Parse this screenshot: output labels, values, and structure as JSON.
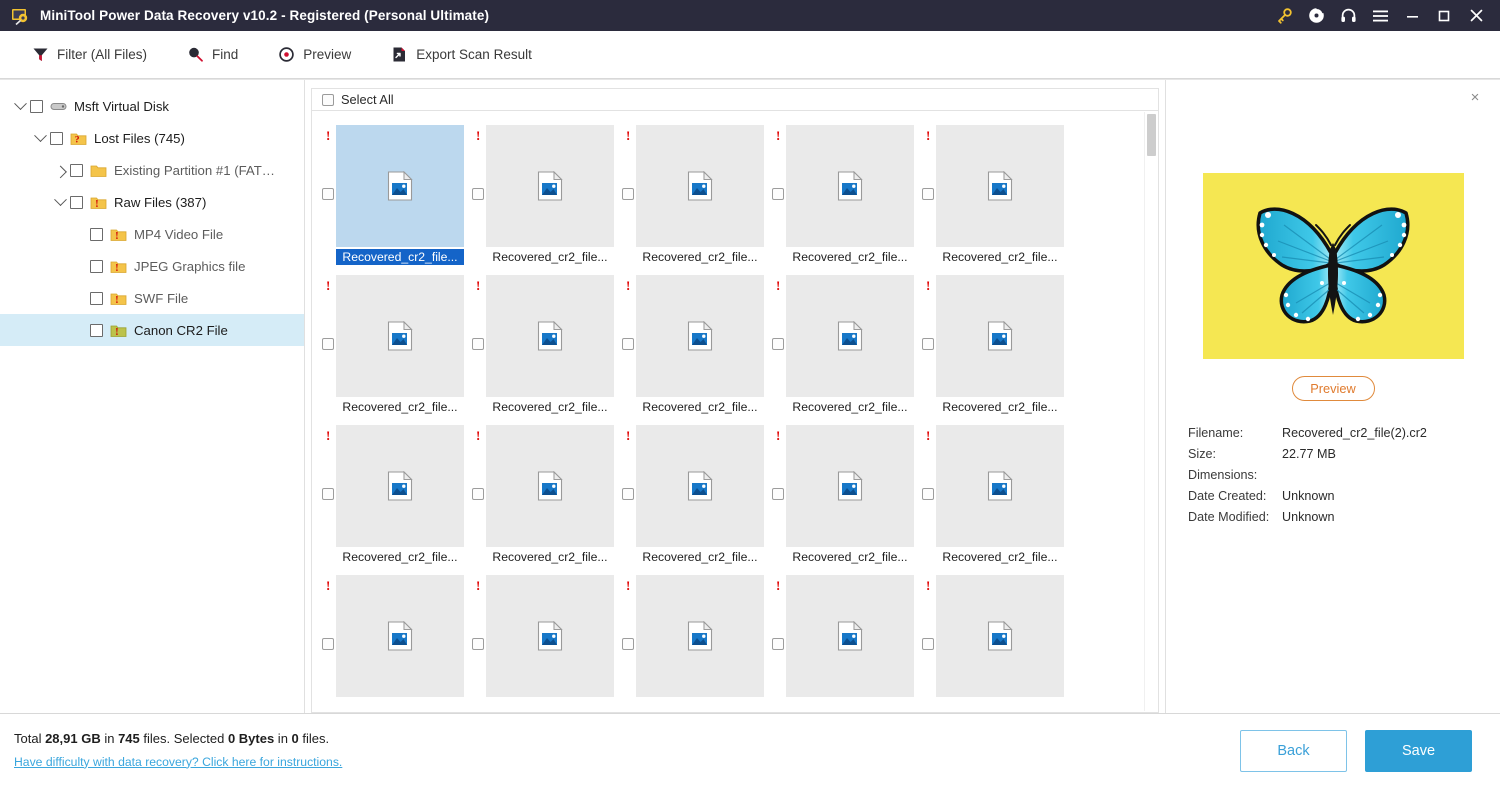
{
  "window": {
    "title": "MiniTool Power Data Recovery v10.2 - Registered (Personal Ultimate)",
    "app_icon": "minitool-app-icon",
    "controls": [
      {
        "name": "key-icon",
        "glyph": "key"
      },
      {
        "name": "disc-icon",
        "glyph": "disc"
      },
      {
        "name": "headphones-icon",
        "glyph": "headphones"
      },
      {
        "name": "menu-icon",
        "glyph": "hamburger"
      },
      {
        "name": "minimize-button",
        "glyph": "minimize"
      },
      {
        "name": "maximize-button",
        "glyph": "maximize"
      },
      {
        "name": "close-button",
        "glyph": "close"
      }
    ]
  },
  "toolbar": {
    "items": [
      {
        "label": "Filter (All Files)",
        "icon": "filter-icon"
      },
      {
        "label": "Find",
        "icon": "search-icon"
      },
      {
        "label": "Preview",
        "icon": "eye-icon"
      },
      {
        "label": "Export Scan Result",
        "icon": "export-icon"
      }
    ]
  },
  "sidebar": {
    "items": [
      {
        "label": "Msft Virtual Disk",
        "indent": 0,
        "twisty": "down",
        "icon": "disk-icon",
        "checked": false,
        "selected": false
      },
      {
        "label": "Lost Files (745)",
        "indent": 1,
        "twisty": "down",
        "icon": "folder-question-icon",
        "checked": false,
        "selected": false
      },
      {
        "label": "Existing Partition #1 (FAT…",
        "indent": 2,
        "twisty": "right",
        "icon": "folder-icon",
        "checked": false,
        "selected": false,
        "dim": true
      },
      {
        "label": "Raw Files (387)",
        "indent": 2,
        "twisty": "down",
        "icon": "folder-alert-icon",
        "checked": false,
        "selected": false
      },
      {
        "label": "MP4 Video File",
        "indent": 3,
        "twisty": "none",
        "icon": "folder-alert-icon",
        "checked": false,
        "selected": false,
        "dim": true
      },
      {
        "label": "JPEG Graphics file",
        "indent": 3,
        "twisty": "none",
        "icon": "folder-alert-icon",
        "checked": false,
        "selected": false,
        "dim": true
      },
      {
        "label": "SWF File",
        "indent": 3,
        "twisty": "none",
        "icon": "folder-alert-icon",
        "checked": false,
        "selected": false,
        "dim": true
      },
      {
        "label": "Canon CR2 File",
        "indent": 3,
        "twisty": "none",
        "icon": "folder-alert-green-icon",
        "checked": false,
        "selected": true
      }
    ]
  },
  "filegrid": {
    "select_all_label": "Select All",
    "select_all_checked": false,
    "files": [
      {
        "name": "Recovered_cr2_file...",
        "selected": true,
        "flag": "!",
        "icon": "image-file-icon",
        "checked": false
      },
      {
        "name": "Recovered_cr2_file...",
        "selected": false,
        "flag": "!",
        "icon": "image-file-icon",
        "checked": false
      },
      {
        "name": "Recovered_cr2_file...",
        "selected": false,
        "flag": "!",
        "icon": "image-file-icon",
        "checked": false
      },
      {
        "name": "Recovered_cr2_file...",
        "selected": false,
        "flag": "!",
        "icon": "image-file-icon",
        "checked": false
      },
      {
        "name": "Recovered_cr2_file...",
        "selected": false,
        "flag": "!",
        "icon": "image-file-icon",
        "checked": false
      },
      {
        "name": "Recovered_cr2_file...",
        "selected": false,
        "flag": "!",
        "icon": "image-file-icon",
        "checked": false
      },
      {
        "name": "Recovered_cr2_file...",
        "selected": false,
        "flag": "!",
        "icon": "image-file-icon",
        "checked": false
      },
      {
        "name": "Recovered_cr2_file...",
        "selected": false,
        "flag": "!",
        "icon": "image-file-icon",
        "checked": false
      },
      {
        "name": "Recovered_cr2_file...",
        "selected": false,
        "flag": "!",
        "icon": "image-file-icon",
        "checked": false
      },
      {
        "name": "Recovered_cr2_file...",
        "selected": false,
        "flag": "!",
        "icon": "image-file-icon",
        "checked": false
      },
      {
        "name": "Recovered_cr2_file...",
        "selected": false,
        "flag": "!",
        "icon": "image-file-icon",
        "checked": false
      },
      {
        "name": "Recovered_cr2_file...",
        "selected": false,
        "flag": "!",
        "icon": "image-file-icon",
        "checked": false
      },
      {
        "name": "Recovered_cr2_file...",
        "selected": false,
        "flag": "!",
        "icon": "image-file-icon",
        "checked": false
      },
      {
        "name": "Recovered_cr2_file...",
        "selected": false,
        "flag": "!",
        "icon": "image-file-icon",
        "checked": false
      },
      {
        "name": "Recovered_cr2_file...",
        "selected": false,
        "flag": "!",
        "icon": "image-file-icon",
        "checked": false
      },
      {
        "name": "",
        "selected": false,
        "flag": "!",
        "icon": "image-file-icon",
        "checked": false
      },
      {
        "name": "",
        "selected": false,
        "flag": "!",
        "icon": "image-file-icon",
        "checked": false
      },
      {
        "name": "",
        "selected": false,
        "flag": "!",
        "icon": "image-file-icon",
        "checked": false
      },
      {
        "name": "",
        "selected": false,
        "flag": "!",
        "icon": "image-file-icon",
        "checked": false
      },
      {
        "name": "",
        "selected": false,
        "flag": "!",
        "icon": "image-file-icon",
        "checked": false
      }
    ]
  },
  "preview": {
    "close_label": "×",
    "image_alt": "blue-butterfly-on-yellow",
    "image_bg": "#f5e752",
    "preview_button": "Preview",
    "meta": [
      {
        "key": "Filename:",
        "value": "Recovered_cr2_file(2).cr2"
      },
      {
        "key": "Size:",
        "value": "22.77 MB"
      },
      {
        "key": "Dimensions:",
        "value": ""
      },
      {
        "key": "Date Created:",
        "value": "Unknown"
      },
      {
        "key": "Date Modified:",
        "value": "Unknown"
      }
    ]
  },
  "status": {
    "total_prefix": "Total ",
    "total_size": "28,91 GB",
    "total_mid": " in ",
    "total_files": "745",
    "total_suffix": " files.  Selected ",
    "selected_size": "0 Bytes",
    "selected_mid": " in ",
    "selected_files": "0",
    "selected_suffix": " files.",
    "help_link": "Have difficulty with data recovery? Click here for instructions.",
    "back_button": "Back",
    "save_button": "Save"
  },
  "colors": {
    "titlebar": "#2b2b3d",
    "accent_blue": "#2e9fd6",
    "selection_blue": "#1464c8",
    "tile_selected": "#bcd8ee",
    "sidebar_selected": "#d5ecf7",
    "alert_red": "#e00000",
    "preview_orange": "#e07b2e",
    "link_blue": "#3aa6dd"
  }
}
